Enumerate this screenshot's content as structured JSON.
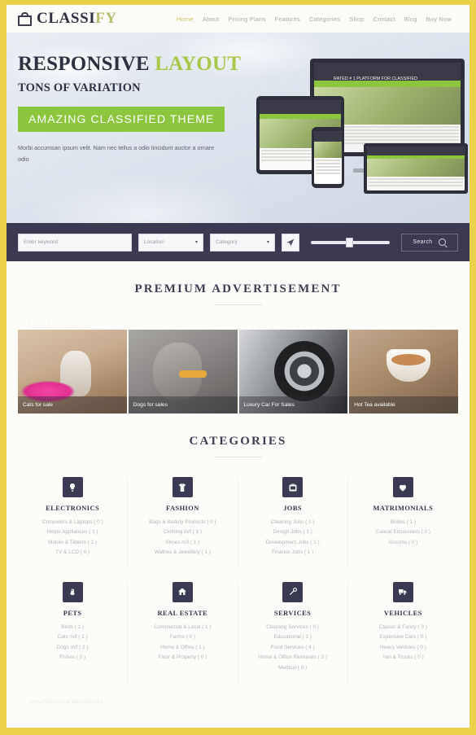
{
  "header": {
    "logo": {
      "part1": "CLASSI",
      "part2": "FY",
      "icon": "shopping-bag-icon"
    },
    "nav": [
      {
        "label": "Home",
        "active": true
      },
      {
        "label": "About",
        "active": false
      },
      {
        "label": "Pricing Plans",
        "active": false
      },
      {
        "label": "Features",
        "active": false
      },
      {
        "label": "Categories",
        "active": false
      },
      {
        "label": "Shop",
        "active": false
      },
      {
        "label": "Contact",
        "active": false
      },
      {
        "label": "Blog",
        "active": false
      },
      {
        "label": "Buy Now",
        "active": false
      }
    ]
  },
  "hero": {
    "title_dark": "RESPONSIVE",
    "title_green": "LAYOUT",
    "subtitle": "TONS OF VARIATION",
    "cta": "AMAZING CLASSIFIED THEME",
    "paragraph": "Morbi accumsan ipsum velit. Nam nec tellus a odio tincidunt auctor a ornare odio",
    "badge": "RATED # 1 PLATFORM FOR CLASSIFIED",
    "accent_green": "#8cc63e",
    "accent_yellow": "#ecd14a"
  },
  "search": {
    "keyword_placeholder": "Enter keyword",
    "location_label": "Location",
    "category_label": "Category",
    "geo_icon": "location-arrow-icon",
    "slider_value": 44,
    "search_label": "Search",
    "search_icon": "search-icon",
    "bar_color": "#3b3a52"
  },
  "premium": {
    "title": "PREMIUM ADVERTISEMENT",
    "prev_icon": "chevron-left-icon",
    "next_icon": "chevron-right-icon",
    "prev_glyph": "‹",
    "next_glyph": "›",
    "ads": [
      {
        "caption": "Cats for sale",
        "image": "cat-in-pink-bed-photo"
      },
      {
        "caption": "Dogs for sales",
        "image": "greyhound-dog-photo"
      },
      {
        "caption": "Luxury Car For Sales",
        "image": "car-wheel-closeup-photo"
      },
      {
        "caption": "Hot Tea available",
        "image": "tea-cup-on-table-photo"
      }
    ]
  },
  "categories": {
    "title": "CATEGORIES",
    "rows": [
      [
        {
          "name": "ELECTRONICS",
          "icon": "lightbulb-icon",
          "items": [
            "Computers & Laptops ( 0 )",
            "Home Appliances ( 1 )",
            "Mobile & Tablets ( 1 )",
            "TV & LCD ( 0 )"
          ]
        },
        {
          "name": "FASHION",
          "icon": "tshirt-icon",
          "items": [
            "Bags & Beauty Products ( 0 )",
            "Clothing m/f ( 1 )",
            "Shoes m/f ( 1 )",
            "Wathes & Jewellery ( 1 )"
          ]
        },
        {
          "name": "JOBS",
          "icon": "briefcase-icon",
          "items": [
            "Cleaning Jobs ( 1 )",
            "Design Jobs ( 1 )",
            "Development Jobs ( 1 )",
            "Finance Jobs ( 1 )"
          ]
        },
        {
          "name": "MATRIMONIALS",
          "icon": "heart-icon",
          "items": [
            "Brides ( 1 )",
            "Casual Encounters ( 0 )",
            "Grooms ( 0 )"
          ]
        }
      ],
      [
        {
          "name": "PETS",
          "icon": "paw-icon",
          "items": [
            "Birds ( 1 )",
            "Cats m/f ( 1 )",
            "Dogs m/f ( 2 )",
            "Fishes ( 0 )"
          ]
        },
        {
          "name": "REAL ESTATE",
          "icon": "home-icon",
          "items": [
            "Commercial & Local ( 1 )",
            "Farms ( 0 )",
            "Home & Office ( 1 )",
            "Floor & Property ( 0 )"
          ]
        },
        {
          "name": "SERVICES",
          "icon": "wrench-icon",
          "items": [
            "Cleaning Services ( 0 )",
            "Educational ( 1 )",
            "Food Services ( 4 )",
            "Home & Office Removals ( 2 )",
            "Medical ( 0 )"
          ]
        },
        {
          "name": "VEHICLES",
          "icon": "truck-icon",
          "items": [
            "Classic & Fancy ( 3 )",
            "Expensive Cars ( 0 )",
            "Heavy Vehicles ( 0 )",
            "Van & Trucks ( 0 )"
          ]
        }
      ]
    ]
  },
  "watermark": "www.ProfessionalTemplates.org"
}
